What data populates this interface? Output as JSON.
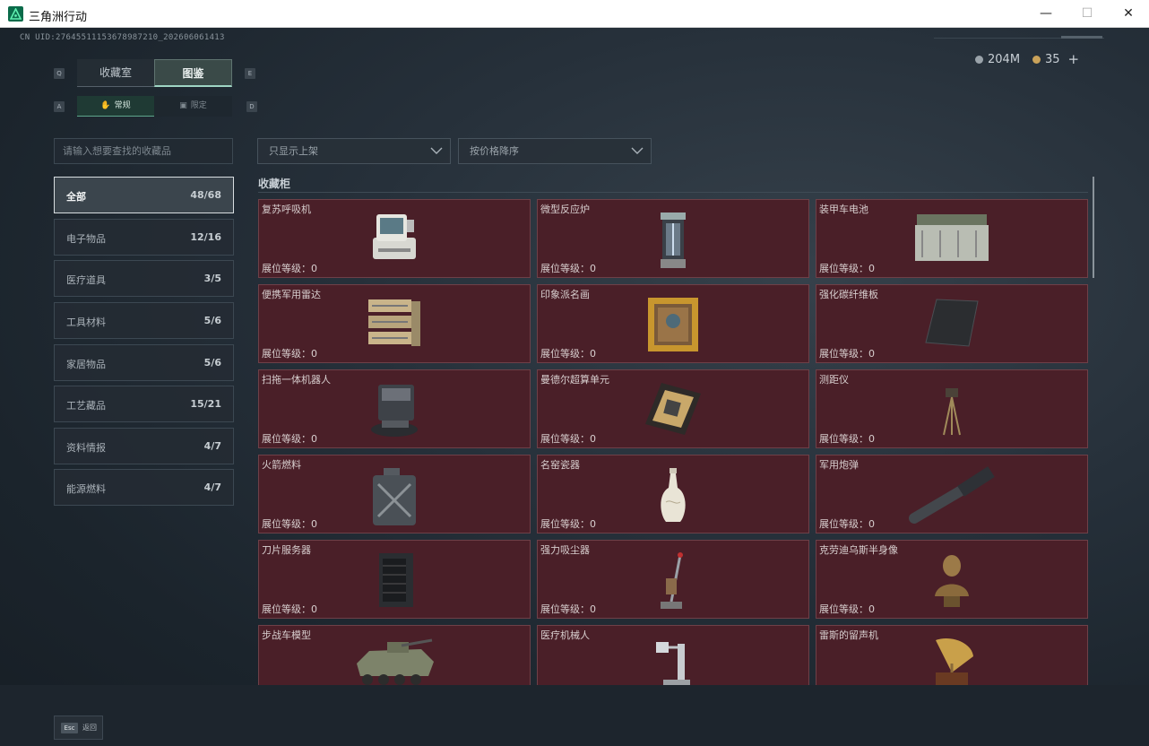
{
  "window": {
    "title": "三角洲行动"
  },
  "header": {
    "uid": "CN UID:27645511153678987210_202606061413",
    "currency": [
      {
        "icon": "silver-coin-icon",
        "value": "204M",
        "color": "#9aa3aa"
      },
      {
        "icon": "gold-coin-icon",
        "value": "35",
        "color": "#c9a25a"
      }
    ],
    "add_label": "+"
  },
  "tabs": {
    "prev_key": "Q",
    "next_key": "E",
    "items": [
      {
        "label": "收藏室",
        "active": false
      },
      {
        "label": "图鉴",
        "active": true
      }
    ]
  },
  "subtabs": {
    "prev_key": "A",
    "next_key": "D",
    "items": [
      {
        "label": "常规",
        "active": true
      },
      {
        "label": "限定",
        "active": false
      }
    ]
  },
  "search": {
    "placeholder": "请输入想要查找的收藏品"
  },
  "filters": {
    "shelf": "只显示上架",
    "sort": "按价格降序"
  },
  "categories": [
    {
      "name": "全部",
      "count": "48/68",
      "active": true
    },
    {
      "name": "电子物品",
      "count": "12/16"
    },
    {
      "name": "医疗道具",
      "count": "3/5"
    },
    {
      "name": "工具材料",
      "count": "5/6"
    },
    {
      "name": "家居物品",
      "count": "5/6"
    },
    {
      "name": "工艺藏品",
      "count": "15/21"
    },
    {
      "name": "资料情报",
      "count": "4/7"
    },
    {
      "name": "能源燃料",
      "count": "4/7"
    }
  ],
  "section": {
    "title": "收藏柜"
  },
  "level_label": "展位等级：",
  "items": [
    {
      "name": "复苏呼吸机",
      "level": "0",
      "icon": "ventilator-icon"
    },
    {
      "name": "微型反应炉",
      "level": "0",
      "icon": "reactor-icon"
    },
    {
      "name": "装甲车电池",
      "level": "0",
      "icon": "battery-icon"
    },
    {
      "name": "便携军用雷达",
      "level": "0",
      "icon": "radar-icon"
    },
    {
      "name": "印象派名画",
      "level": "0",
      "icon": "painting-icon"
    },
    {
      "name": "强化碳纤维板",
      "level": "0",
      "icon": "carbon-plate-icon"
    },
    {
      "name": "扫拖一体机器人",
      "level": "0",
      "icon": "robot-vacuum-icon"
    },
    {
      "name": "曼德尔超算单元",
      "level": "0",
      "icon": "compute-unit-icon"
    },
    {
      "name": "测距仪",
      "level": "0",
      "icon": "rangefinder-icon"
    },
    {
      "name": "火箭燃料",
      "level": "0",
      "icon": "fuel-can-icon"
    },
    {
      "name": "名窑瓷器",
      "level": "0",
      "icon": "porcelain-vase-icon"
    },
    {
      "name": "军用炮弹",
      "level": "0",
      "icon": "artillery-shell-icon"
    },
    {
      "name": "刀片服务器",
      "level": "0",
      "icon": "blade-server-icon"
    },
    {
      "name": "强力吸尘器",
      "level": "0",
      "icon": "vacuum-cleaner-icon"
    },
    {
      "name": "克劳迪乌斯半身像",
      "level": "0",
      "icon": "bust-statue-icon"
    },
    {
      "name": "步战车模型",
      "level": "",
      "icon": "ifv-model-icon"
    },
    {
      "name": "医疗机械人",
      "level": "",
      "icon": "medical-robot-icon"
    },
    {
      "name": "雷斯的留声机",
      "level": "",
      "icon": "gramophone-icon"
    }
  ],
  "footer": {
    "esc_key": "Esc",
    "back_label": "返回"
  },
  "colors": {
    "card_bg": "#4a1f28",
    "accent": "#9fd6c4"
  }
}
